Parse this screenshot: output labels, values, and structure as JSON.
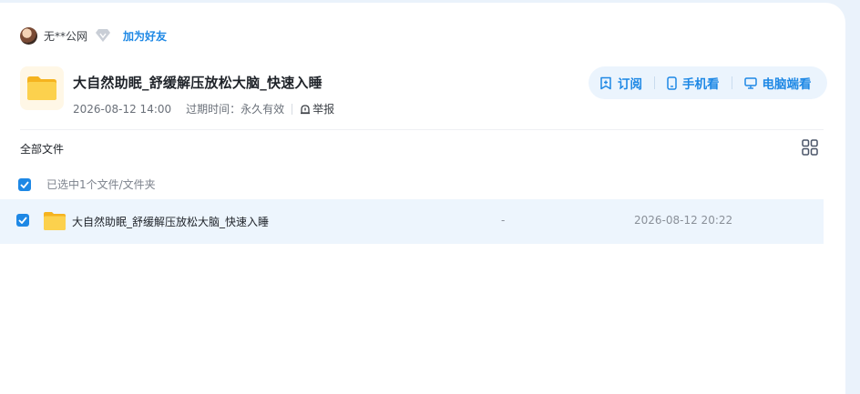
{
  "user": {
    "name": "无**公网",
    "add_friend": "加为好友"
  },
  "share": {
    "title": "大自然助眠_舒缓解压放松大脑_快速入睡",
    "created": "2026-08-12 14:00",
    "expire": "过期时间：永久有效",
    "report": "举报"
  },
  "actions": {
    "subscribe": "订阅",
    "mobile": "手机看",
    "desktop": "电脑端看"
  },
  "listing": {
    "all_files": "全部文件",
    "selected_text": "已选中1个文件/文件夹",
    "files": [
      {
        "name": "大自然助眠_舒缓解压放松大脑_快速入睡",
        "size": "-",
        "date": "2026-08-12 20:22"
      }
    ]
  },
  "colors": {
    "accent": "#1e88e5",
    "page_bg": "#eaf2fb",
    "row_selected": "#edf5fd",
    "folder": "#f7c23a"
  }
}
